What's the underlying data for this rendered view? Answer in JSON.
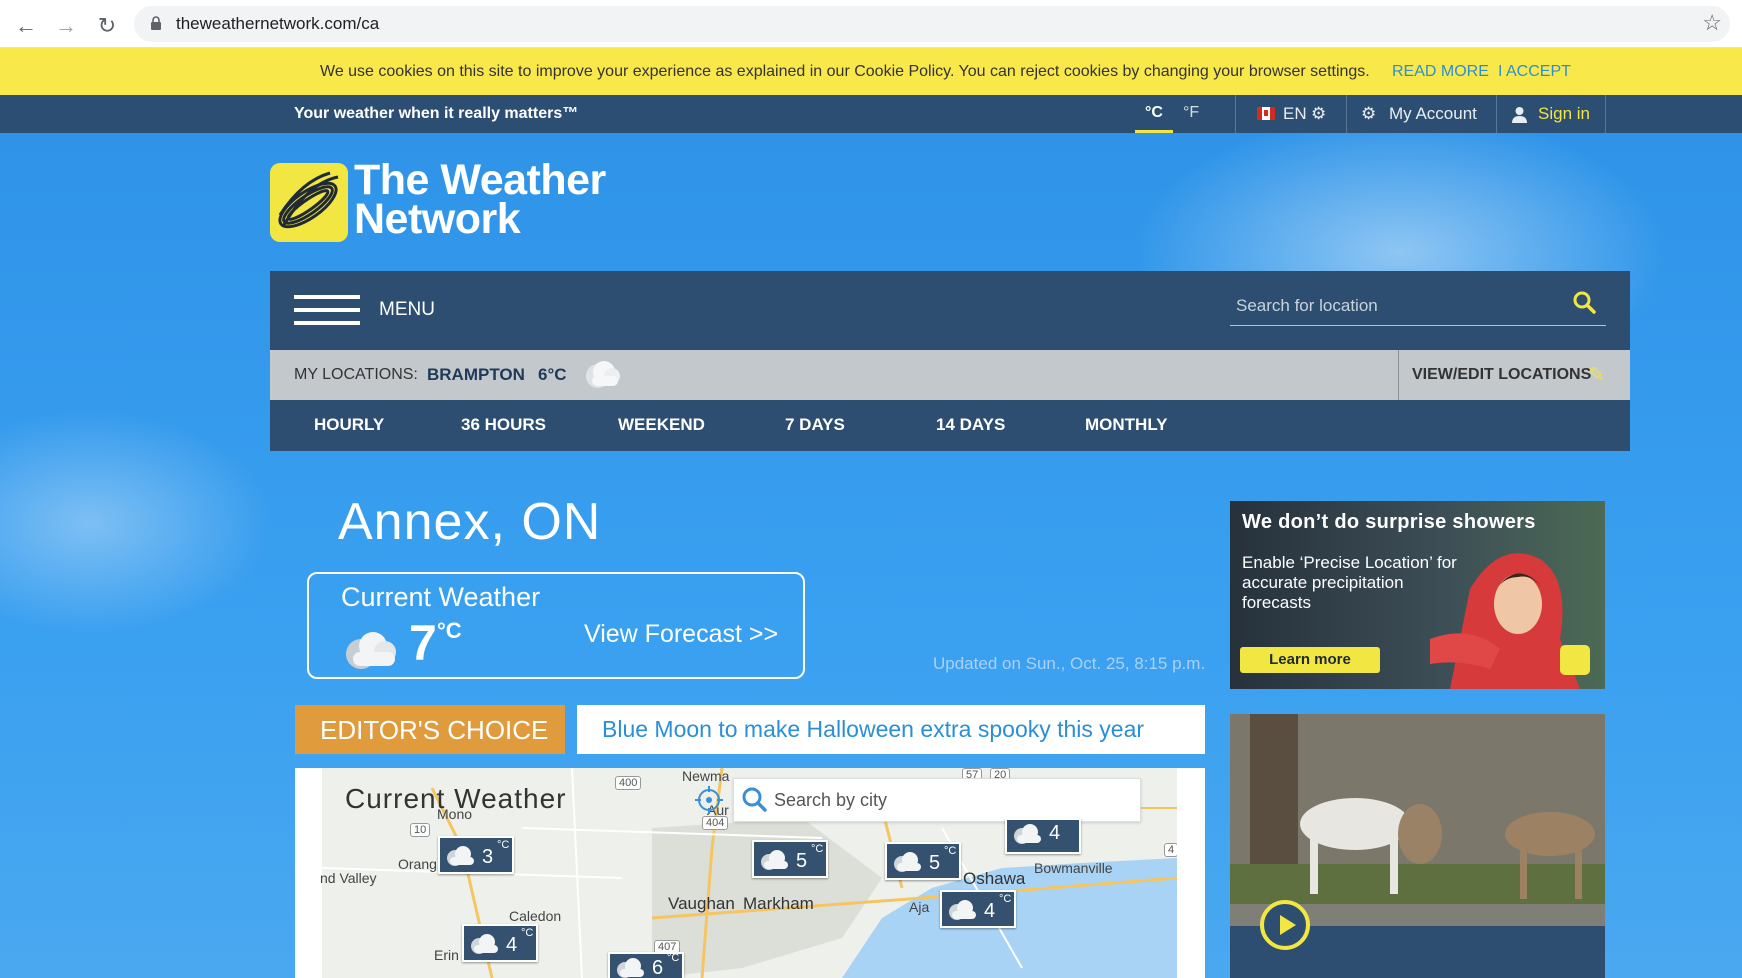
{
  "browser": {
    "url": "theweathernetwork.com/ca"
  },
  "cookie": {
    "text": "We use cookies on this site to improve your experience as explained in our Cookie Policy. You can reject cookies by changing your browser settings.",
    "read_more": "READ MORE",
    "accept": "I ACCEPT"
  },
  "topbar": {
    "tagline": "Your weather when it really matters™",
    "unit_c": "°C",
    "unit_f": "°F",
    "language": "EN",
    "my_account": "My Account",
    "sign_in": "Sign in"
  },
  "logo": {
    "line1": "The Weather",
    "line2": "Network"
  },
  "menu": {
    "label": "MENU",
    "search_placeholder": "Search for location"
  },
  "my_locations": {
    "label": "MY LOCATIONS:",
    "city": "BRAMPTON",
    "temp": "6°C",
    "edit": "VIEW/EDIT LOCATIONS"
  },
  "tabs": [
    "HOURLY",
    "36 HOURS",
    "WEEKEND",
    "7 DAYS",
    "14 DAYS",
    "MONTHLY"
  ],
  "city": "Annex, ON",
  "current": {
    "title": "Current Weather",
    "temp": "7",
    "unit": "°C",
    "link": "View Forecast >>",
    "updated": "Updated on Sun., Oct. 25, 8:15 p.m."
  },
  "editors_choice": {
    "badge": "EDITOR'S CHOICE",
    "headline": "Blue Moon to make Halloween extra spooky this year"
  },
  "map": {
    "title": "Current Weather",
    "search_placeholder": "Search by city",
    "markers": [
      "3",
      "5",
      "5",
      "4",
      "4",
      "4",
      "6"
    ],
    "marker_unit": "°C",
    "places": {
      "orangeville": "Orang",
      "valley": "nd Valley",
      "caledon": "Caledon",
      "erin": "Erin",
      "vaughan": "Vaughan",
      "markham": "Markham",
      "oshawa": "Oshawa",
      "bowmanville": "Bowmanville",
      "ajax": "Aja",
      "newmarket": "Newma",
      "mono": "Mono",
      "aurora": "Aur"
    },
    "shields": [
      "400",
      "10",
      "404",
      "407",
      "400",
      "57",
      "20",
      "4"
    ]
  },
  "ad1": {
    "title": "We don’t do surprise showers",
    "body": "Enable ‘Precise Location’ for accurate precipitation forecasts",
    "button": "Learn more"
  },
  "colors": {
    "brand_yellow": "#f2e643",
    "nav_blue": "#2d4e71",
    "sky_blue": "#3aa0f0",
    "link_blue": "#2a8fd6",
    "editor_orange": "#e09b3d"
  }
}
